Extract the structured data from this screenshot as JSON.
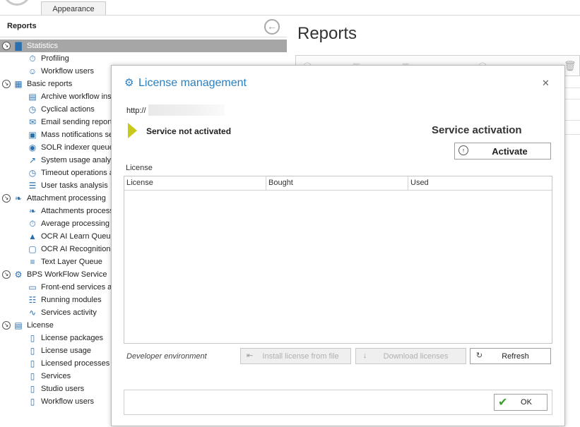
{
  "top": {
    "appearance_tab": "Appearance"
  },
  "left": {
    "title": "Reports",
    "tree": [
      {
        "label": "Statistics",
        "icon": "chart-icon",
        "level": 0,
        "selected": true
      },
      {
        "label": "Profiling",
        "icon": "stopwatch-icon",
        "level": 1
      },
      {
        "label": "Workflow users",
        "icon": "users-icon",
        "level": 1
      },
      {
        "label": "Basic reports",
        "icon": "table-icon",
        "level": 0
      },
      {
        "label": "Archive workflow ins",
        "icon": "archive-icon",
        "level": 1
      },
      {
        "label": "Cyclical actions",
        "icon": "clock-icon",
        "level": 1
      },
      {
        "label": "Email sending report",
        "icon": "email-icon",
        "level": 1
      },
      {
        "label": "Mass notifications se",
        "icon": "notifications-icon",
        "level": 1
      },
      {
        "label": "SOLR indexer queue",
        "icon": "solr-icon",
        "level": 1
      },
      {
        "label": "System usage analys",
        "icon": "line-chart-icon",
        "level": 1
      },
      {
        "label": "Timeout operations a",
        "icon": "clock-icon",
        "level": 1
      },
      {
        "label": "User tasks analysis",
        "icon": "task-list-icon",
        "level": 1
      },
      {
        "label": "Attachment processing",
        "icon": "paperclip-icon",
        "level": 0
      },
      {
        "label": "Attachments process",
        "icon": "paperclip-icon",
        "level": 1
      },
      {
        "label": "Average processing",
        "icon": "stopwatch-icon",
        "level": 1
      },
      {
        "label": "OCR AI Learn Queue",
        "icon": "graduation-cap-icon",
        "level": 1
      },
      {
        "label": "OCR AI Recognition",
        "icon": "ocr-icon",
        "level": 1
      },
      {
        "label": "Text Layer Queue",
        "icon": "text-layer-icon",
        "level": 1
      },
      {
        "label": "BPS WorkFlow Service",
        "icon": "gears-icon",
        "level": 0
      },
      {
        "label": "Front-end services a",
        "icon": "monitor-icon",
        "level": 1
      },
      {
        "label": "Running modules",
        "icon": "modules-icon",
        "level": 1
      },
      {
        "label": "Services activity",
        "icon": "pulse-icon",
        "level": 1
      },
      {
        "label": "License",
        "icon": "certificate-icon",
        "level": 0
      },
      {
        "label": "License packages",
        "icon": "license-doc-icon",
        "level": 1
      },
      {
        "label": "License usage",
        "icon": "license-doc-icon",
        "level": 1
      },
      {
        "label": "Licensed processes",
        "icon": "license-doc-icon",
        "level": 1
      },
      {
        "label": "Services",
        "icon": "license-doc-icon",
        "level": 1
      },
      {
        "label": "Studio users",
        "icon": "license-doc-icon",
        "level": 1
      },
      {
        "label": "Workflow users",
        "icon": "license-doc-icon",
        "level": 1
      }
    ]
  },
  "main": {
    "title": "Reports"
  },
  "dialog": {
    "title": "License management",
    "url_prefix": "http://",
    "status": "Service not activated",
    "activation_heading": "Service activation",
    "activate_label": "Activate",
    "license_caption": "License",
    "columns": [
      "License",
      "Bought",
      "Used"
    ],
    "developer_env": "Developer environment",
    "install_label": "Install license from file",
    "download_label": "Download licenses",
    "refresh_label": "Refresh",
    "ok_label": "OK",
    "colors": {
      "accent": "#2a7fc1",
      "warning": "#c9c91a",
      "selected": "#a6a6a6",
      "ok_check": "#3a9e2c"
    }
  }
}
